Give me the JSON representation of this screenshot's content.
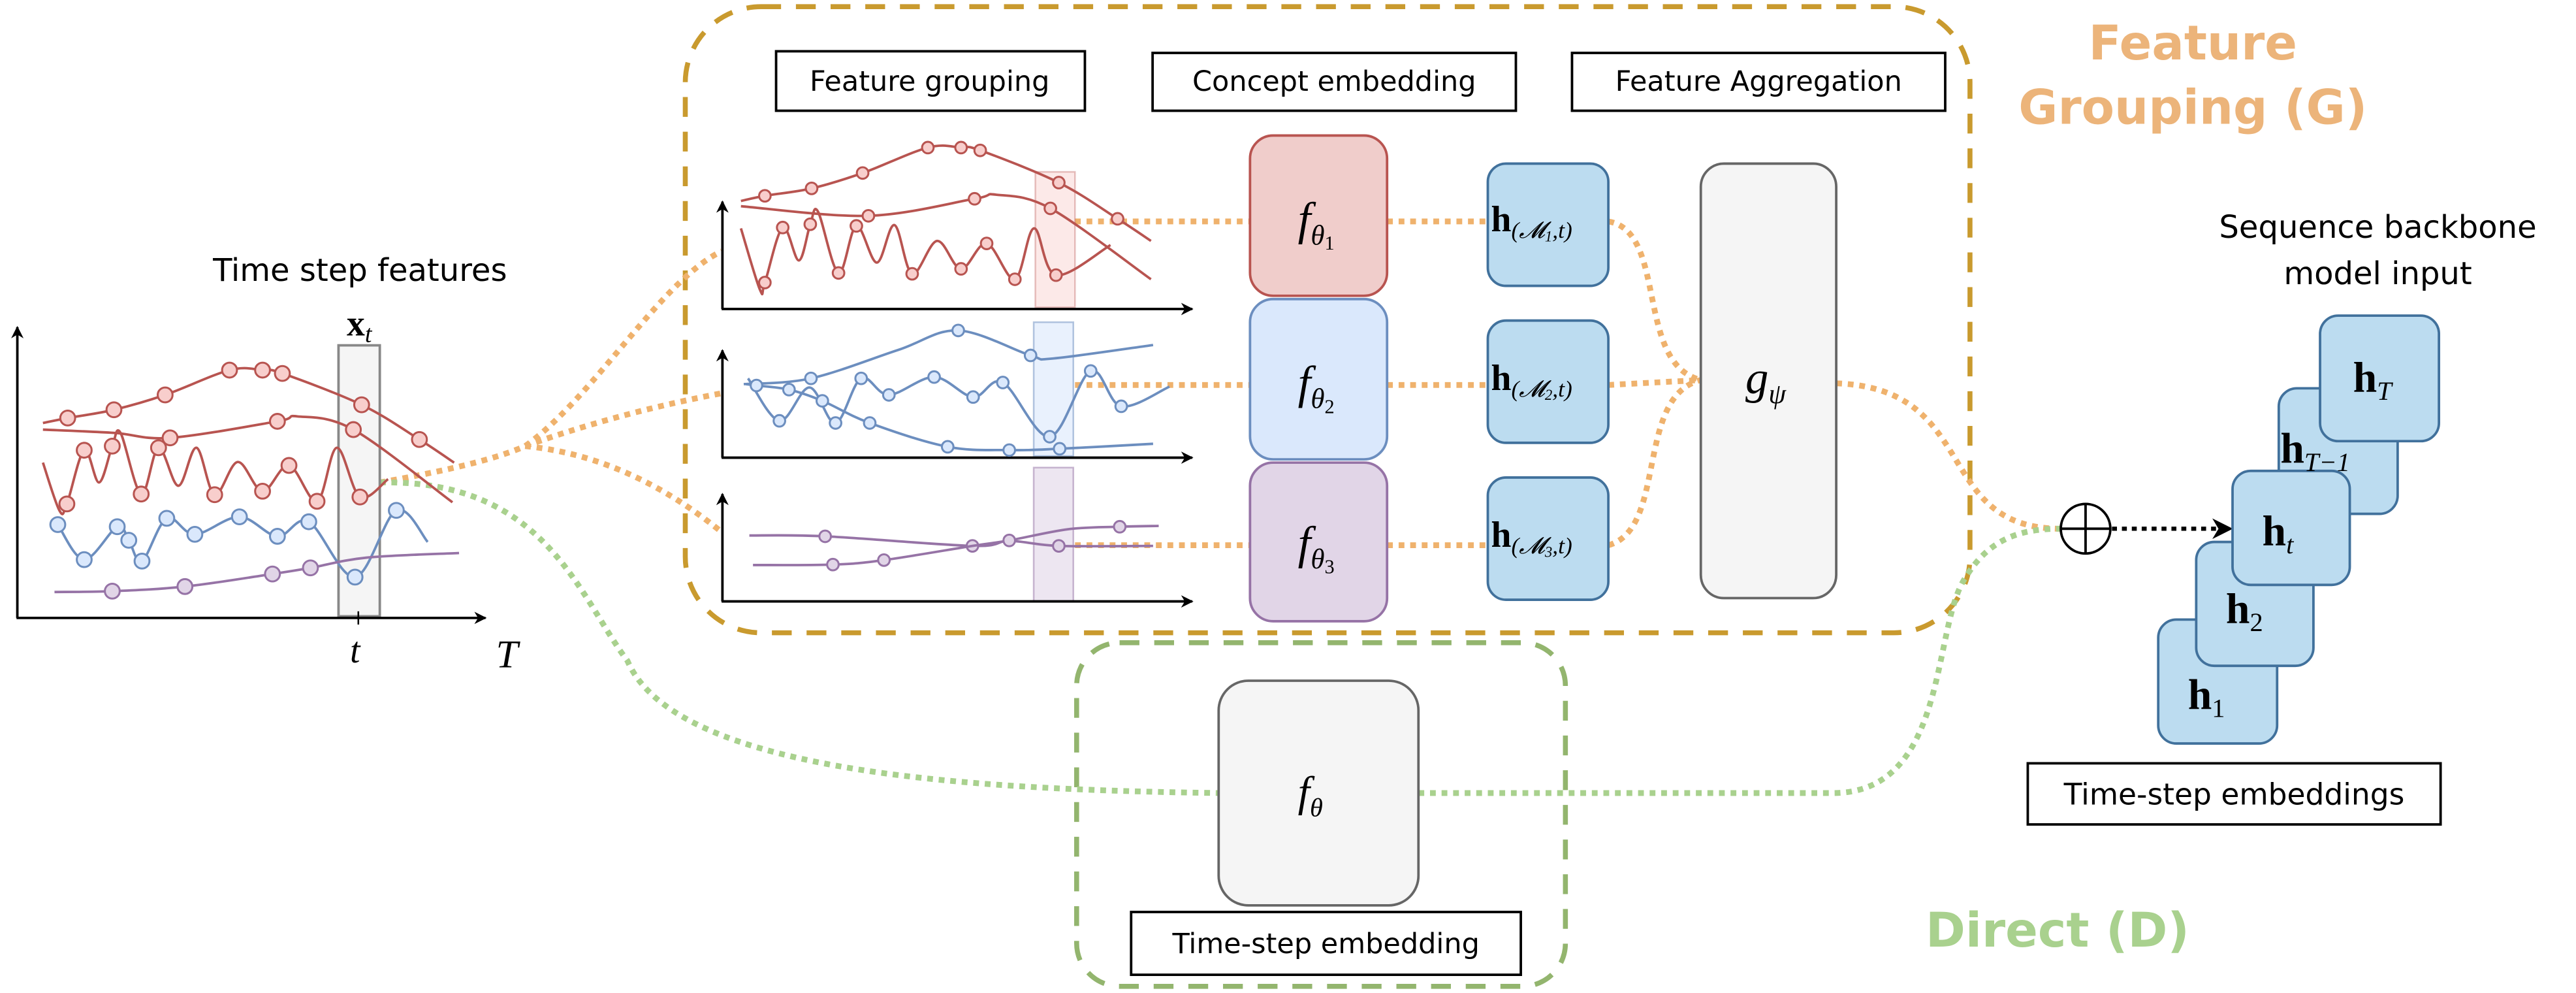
{
  "colors": {
    "grouping_frame": "#c99a2e",
    "grouping_path": "#efb26d",
    "grouping_title": "#ecb47a",
    "direct_frame": "#93b56e",
    "direct_path": "#a9d18e",
    "direct_title": "#a9d18e",
    "red_series": "#b85450",
    "red_fill": "#f8cecc",
    "blue_series": "#6c8ebf",
    "blue_fill": "#dae8fc",
    "purple_series": "#9673a6",
    "purple_fill": "#e1d5e7",
    "embedding_fill": "#bcdcf0",
    "embedding_stroke": "#41719c",
    "neutral_fill": "#f5f5f5",
    "neutral_stroke": "#666666"
  },
  "input": {
    "title": "Time step features",
    "window_label": {
      "base": "x",
      "sub": "t"
    },
    "tick_label": "t",
    "axis_label": "T"
  },
  "grouping": {
    "title_line1": "Feature",
    "title_line2": "Grouping (G)",
    "stage_labels": [
      "Feature grouping",
      "Concept embedding",
      "Feature Aggregation"
    ],
    "concept_encoders": [
      {
        "base": "f",
        "sub": "θ",
        "subsub": "1"
      },
      {
        "base": "f",
        "sub": "θ",
        "subsub": "2"
      },
      {
        "base": "f",
        "sub": "θ",
        "subsub": "3"
      }
    ],
    "concept_embeddings": [
      {
        "base": "h",
        "sub": "(𝓜",
        "subsub": "1",
        "tail": ",t)"
      },
      {
        "base": "h",
        "sub": "(𝓜",
        "subsub": "2",
        "tail": ",t)"
      },
      {
        "base": "h",
        "sub": "(𝓜",
        "subsub": "3",
        "tail": ",t)"
      }
    ],
    "aggregator": {
      "base": "g",
      "sub": "ψ"
    }
  },
  "direct": {
    "title": "Direct (D)",
    "encoder": {
      "base": "f",
      "sub": "θ"
    },
    "label": "Time-step embedding"
  },
  "output": {
    "title_line1": "Sequence backbone",
    "title_line2": "model input",
    "combine_icon": "circled-plus-icon",
    "embeddings": [
      {
        "base": "h",
        "sub": "1"
      },
      {
        "base": "h",
        "sub": "2"
      },
      {
        "base": "h",
        "sub": "t"
      },
      {
        "base": "h",
        "sub": "T−1"
      },
      {
        "base": "h",
        "sub": "T"
      }
    ],
    "label": "Time-step embeddings"
  }
}
